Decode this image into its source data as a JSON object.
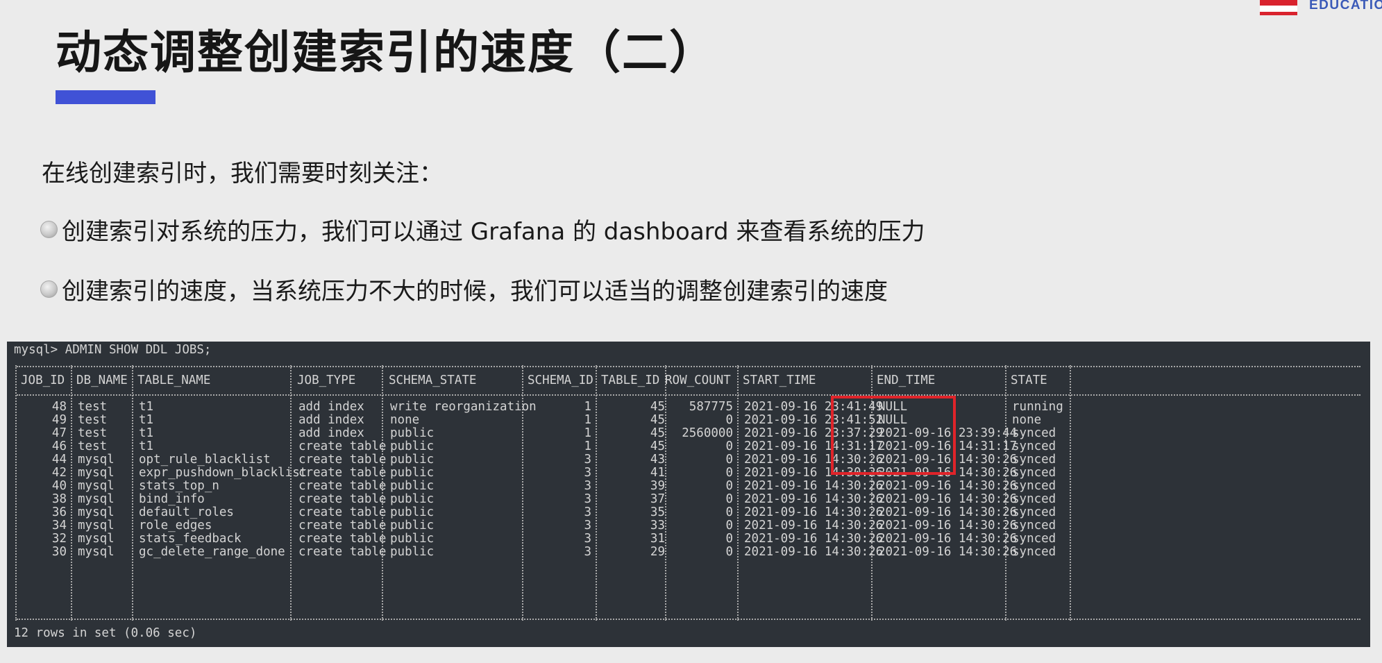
{
  "brand": {
    "text": "EDUCATION"
  },
  "slide": {
    "title": "动态调整创建索引的速度（二）",
    "intro": "在线创建索引时，我们需要时刻关注：",
    "bullets": [
      "创建索引对系统的压力，我们可以通过 Grafana 的 dashboard 来查看系统的压力",
      "创建索引的速度，当系统压力不大的时候，我们可以适当的调整创建索引的速度"
    ]
  },
  "terminal": {
    "command": "mysql> ADMIN SHOW DDL JOBS;",
    "headers": [
      "JOB_ID",
      "DB_NAME",
      "TABLE_NAME",
      "JOB_TYPE",
      "SCHEMA_STATE",
      "SCHEMA_ID",
      "TABLE_ID",
      "ROW_COUNT",
      "START_TIME",
      "END_TIME",
      "STATE"
    ],
    "rows": [
      [
        "48",
        "test",
        "t1",
        "add index",
        "write reorganization",
        "1",
        "45",
        "587775",
        "2021-09-16 23:41:49",
        "NULL",
        "running"
      ],
      [
        "49",
        "test",
        "t1",
        "add index",
        "none",
        "1",
        "45",
        "0",
        "2021-09-16 23:41:52",
        "NULL",
        "none"
      ],
      [
        "47",
        "test",
        "t1",
        "add index",
        "public",
        "1",
        "45",
        "2560000",
        "2021-09-16 23:37:29",
        "2021-09-16 23:39:44",
        "synced"
      ],
      [
        "46",
        "test",
        "t1",
        "create table",
        "public",
        "1",
        "45",
        "0",
        "2021-09-16 14:31:17",
        "2021-09-16 14:31:17",
        "synced"
      ],
      [
        "44",
        "mysql",
        "opt_rule_blacklist",
        "create table",
        "public",
        "3",
        "43",
        "0",
        "2021-09-16 14:30:26",
        "2021-09-16 14:30:26",
        "synced"
      ],
      [
        "42",
        "mysql",
        "expr_pushdown_blacklist",
        "create table",
        "public",
        "3",
        "41",
        "0",
        "2021-09-16 14:30:26",
        "2021-09-16 14:30:26",
        "synced"
      ],
      [
        "40",
        "mysql",
        "stats_top_n",
        "create table",
        "public",
        "3",
        "39",
        "0",
        "2021-09-16 14:30:26",
        "2021-09-16 14:30:26",
        "synced"
      ],
      [
        "38",
        "mysql",
        "bind_info",
        "create table",
        "public",
        "3",
        "37",
        "0",
        "2021-09-16 14:30:26",
        "2021-09-16 14:30:26",
        "synced"
      ],
      [
        "36",
        "mysql",
        "default_roles",
        "create table",
        "public",
        "3",
        "35",
        "0",
        "2021-09-16 14:30:26",
        "2021-09-16 14:30:26",
        "synced"
      ],
      [
        "34",
        "mysql",
        "role_edges",
        "create table",
        "public",
        "3",
        "33",
        "0",
        "2021-09-16 14:30:26",
        "2021-09-16 14:30:26",
        "synced"
      ],
      [
        "32",
        "mysql",
        "stats_feedback",
        "create table",
        "public",
        "3",
        "31",
        "0",
        "2021-09-16 14:30:26",
        "2021-09-16 14:30:26",
        "synced"
      ],
      [
        "30",
        "mysql",
        "gc_delete_range_done",
        "create table",
        "public",
        "3",
        "29",
        "0",
        "2021-09-16 14:30:26",
        "2021-09-16 14:30:26",
        "synced"
      ]
    ],
    "footer": "12 rows in set (0.06 sec)"
  },
  "colors": {
    "accent": "#4052d6",
    "highlight": "#e0242a",
    "terminal_bg": "#2d3238"
  }
}
